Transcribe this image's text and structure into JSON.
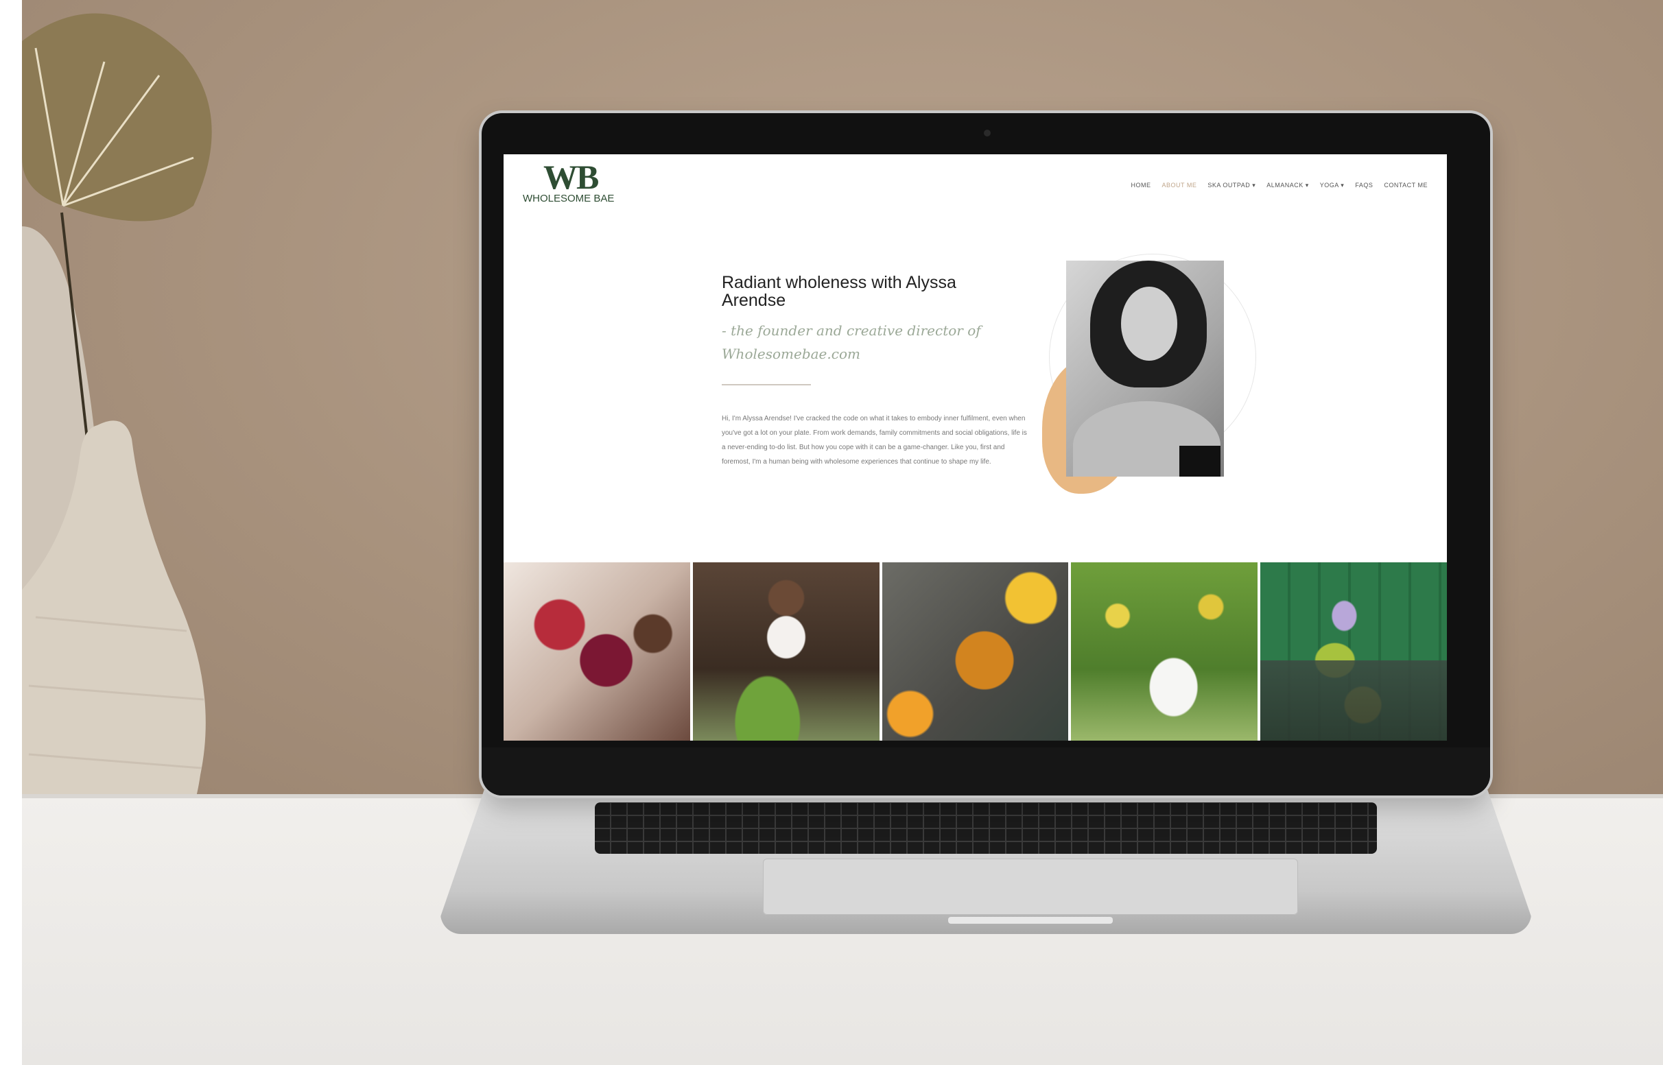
{
  "site": {
    "logo": {
      "mark": "WB",
      "text": "WHOLESOME BAE"
    },
    "nav": [
      {
        "label": "HOME",
        "active": false
      },
      {
        "label": "ABOUT ME",
        "active": true
      },
      {
        "label": "SKA OUTPAD ▾",
        "active": false
      },
      {
        "label": "ALMANACK ▾",
        "active": false
      },
      {
        "label": "YOGA ▾",
        "active": false
      },
      {
        "label": "FAQS",
        "active": false
      },
      {
        "label": "CONTACT ME",
        "active": false
      }
    ],
    "hero": {
      "title": "Radiant wholeness with Alyssa Arendse",
      "script": "- the founder and creative director of Wholesomebae.com",
      "body": "Hi, I'm Alyssa Arendse! I've cracked the code on what it takes to embody inner fulfilment, even when you've got a lot on your plate. From work demands, family commitments and social obligations, life is a never-ending to-do list. But how you cope with it can be a game-changer. Like you, first and foremost, I'm a human being with wholesome experiences that continue to shape my life."
    },
    "gallery": [
      "pomegranate-smoothie-photo",
      "kitchen-cooking-photo",
      "turmeric-mortar-photo",
      "lemon-tree-photo",
      "green-juice-photo"
    ]
  },
  "colors": {
    "accent": "#bfa58a",
    "logo_green": "#2e4d33",
    "blob": "#e8b883",
    "wall": "#a8927d"
  }
}
